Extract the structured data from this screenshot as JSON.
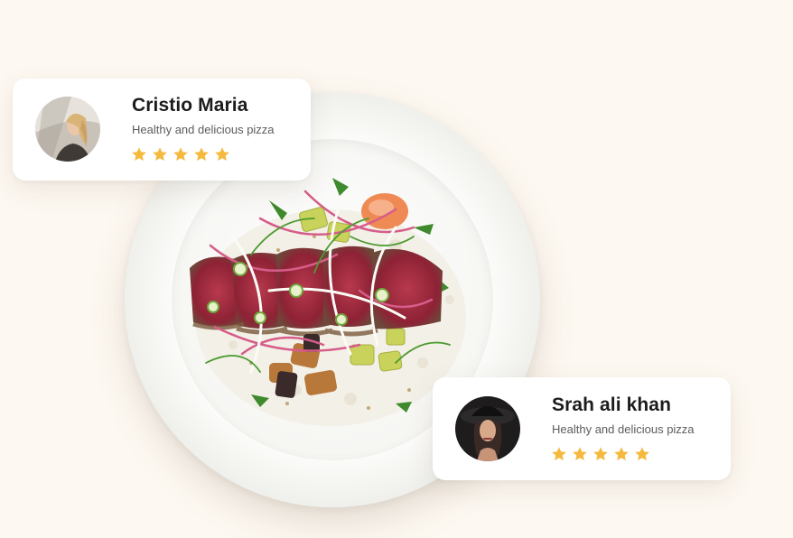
{
  "reviews": [
    {
      "name": "Cristio Maria",
      "text": "Healthy and delicious pizza",
      "rating": 5,
      "avatar_icon": "woman-portrait-avatar"
    },
    {
      "name": "Srah ali khan",
      "text": "Healthy and delicious pizza",
      "rating": 5,
      "avatar_icon": "woman-hat-portrait-avatar"
    }
  ],
  "colors": {
    "background": "#fdf8f1",
    "card": "#ffffff",
    "star": "#f5b93e",
    "title": "#1c1c1c",
    "subtitle": "#5c5c5c"
  },
  "dish_image": "seared-tuna-poke-bowl-plate"
}
